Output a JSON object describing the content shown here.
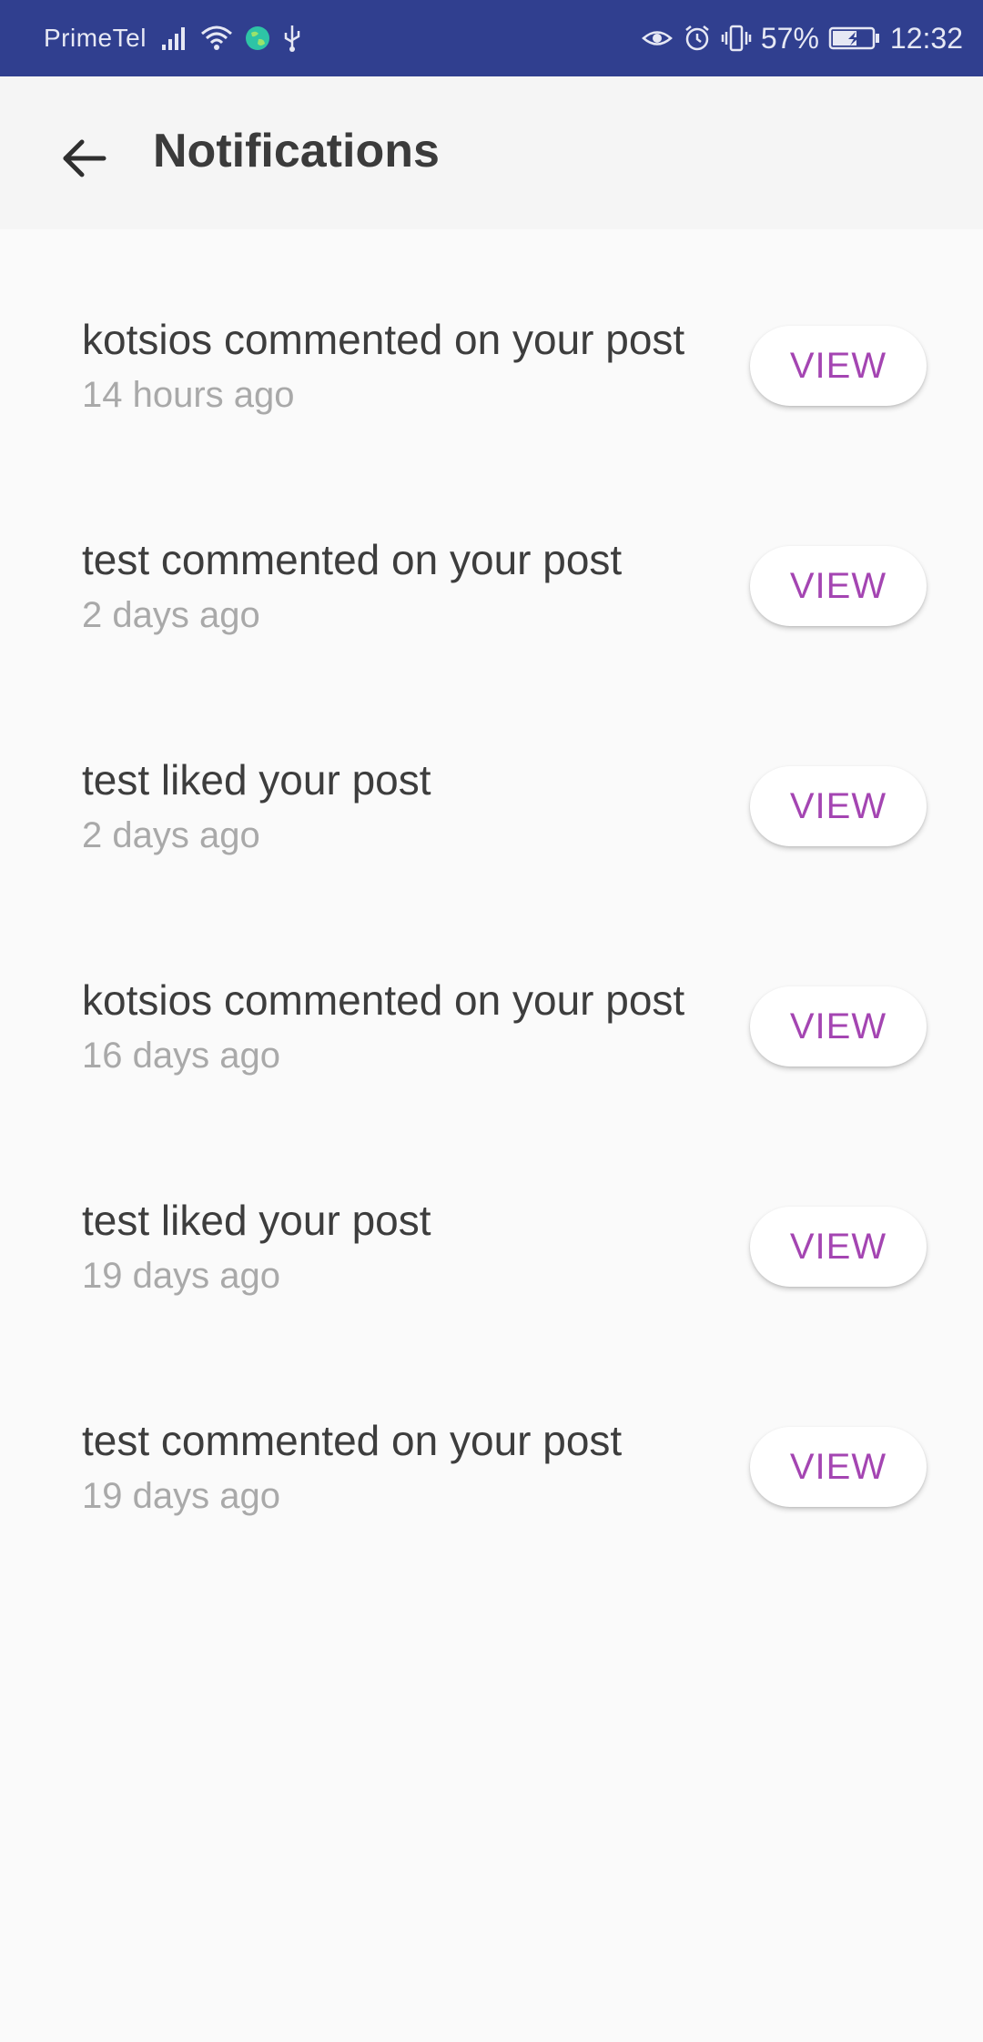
{
  "status_bar": {
    "carrier": "PrimeTel",
    "battery": "57%",
    "time": "12:32",
    "icons": [
      "signal-icon",
      "wifi-icon",
      "globe-icon",
      "usb-icon",
      "eye-icon",
      "alarm-icon",
      "vibrate-icon",
      "battery-icon"
    ],
    "background_color": "#303f8f"
  },
  "app_bar": {
    "title": "Notifications",
    "back_icon": "arrow-back-icon"
  },
  "notifications": [
    {
      "text": "kotsios commented on your post",
      "time": "14 hours ago",
      "action": "VIEW"
    },
    {
      "text": "test commented on your post",
      "time": "2 days ago",
      "action": "VIEW"
    },
    {
      "text": "test liked your post",
      "time": "2 days ago",
      "action": "VIEW"
    },
    {
      "text": "kotsios commented on your post",
      "time": "16 days ago",
      "action": "VIEW"
    },
    {
      "text": "test liked your post",
      "time": "19 days ago",
      "action": "VIEW"
    },
    {
      "text": "test commented on your post",
      "time": "19 days ago",
      "action": "VIEW"
    }
  ],
  "colors": {
    "accent": "#a445b2",
    "primary_text": "#3d3d3d",
    "secondary_text": "#a9a9a9"
  }
}
